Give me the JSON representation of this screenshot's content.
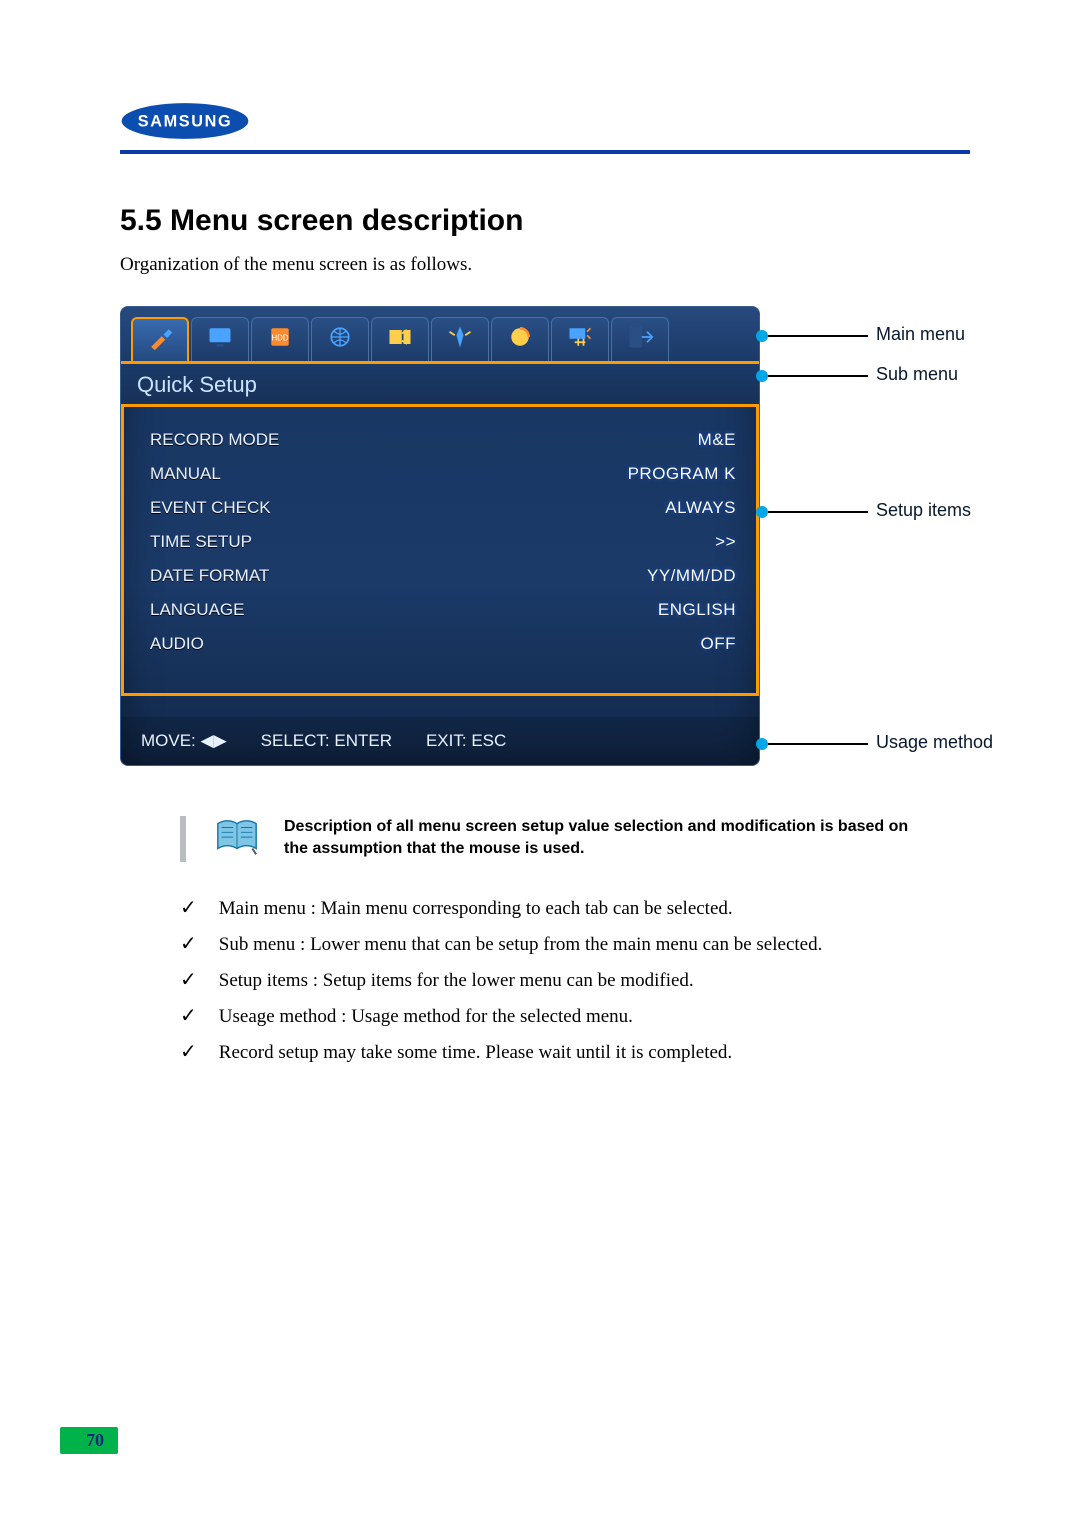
{
  "brand": "SAMSUNG",
  "section_title": "5.5 Menu screen description",
  "intro": "Organization of the menu screen is as follows.",
  "callouts": {
    "main_menu": "Main menu",
    "sub_menu": "Sub menu",
    "setup_items": "Setup items",
    "usage_method": "Usage method"
  },
  "osd": {
    "sub_title": "Quick Setup",
    "tabs": [
      {
        "name": "quick-setup",
        "active": true
      },
      {
        "name": "display"
      },
      {
        "name": "hdd"
      },
      {
        "name": "network"
      },
      {
        "name": "record"
      },
      {
        "name": "event"
      },
      {
        "name": "backup"
      },
      {
        "name": "system"
      },
      {
        "name": "exit"
      }
    ],
    "items": [
      {
        "label": "RECORD MODE",
        "value": "M&E"
      },
      {
        "label": "MANUAL",
        "value": "PROGRAM K"
      },
      {
        "label": "EVENT CHECK",
        "value": "ALWAYS"
      },
      {
        "label": "TIME SETUP",
        "value": ">>"
      },
      {
        "label": "DATE FORMAT",
        "value": "YY/MM/DD"
      },
      {
        "label": "LANGUAGE",
        "value": "ENGLISH"
      },
      {
        "label": "AUDIO",
        "value": "OFF"
      }
    ],
    "usage": {
      "move": "MOVE: ◀▶",
      "select": "SELECT: ENTER",
      "exit": "EXIT: ESC"
    }
  },
  "note": "Description of all menu screen setup value selection and modification is based on the assumption that the mouse is used.",
  "bullets": [
    "Main menu : Main menu corresponding to each tab can be selected.",
    "Sub menu : Lower menu that can be setup from the main menu can be selected.",
    "Setup items : Setup items for the lower menu can be modified.",
    "Useage method : Usage method for the selected menu.",
    "Record setup may take some time. Please wait until it is completed."
  ],
  "page_number": "70"
}
